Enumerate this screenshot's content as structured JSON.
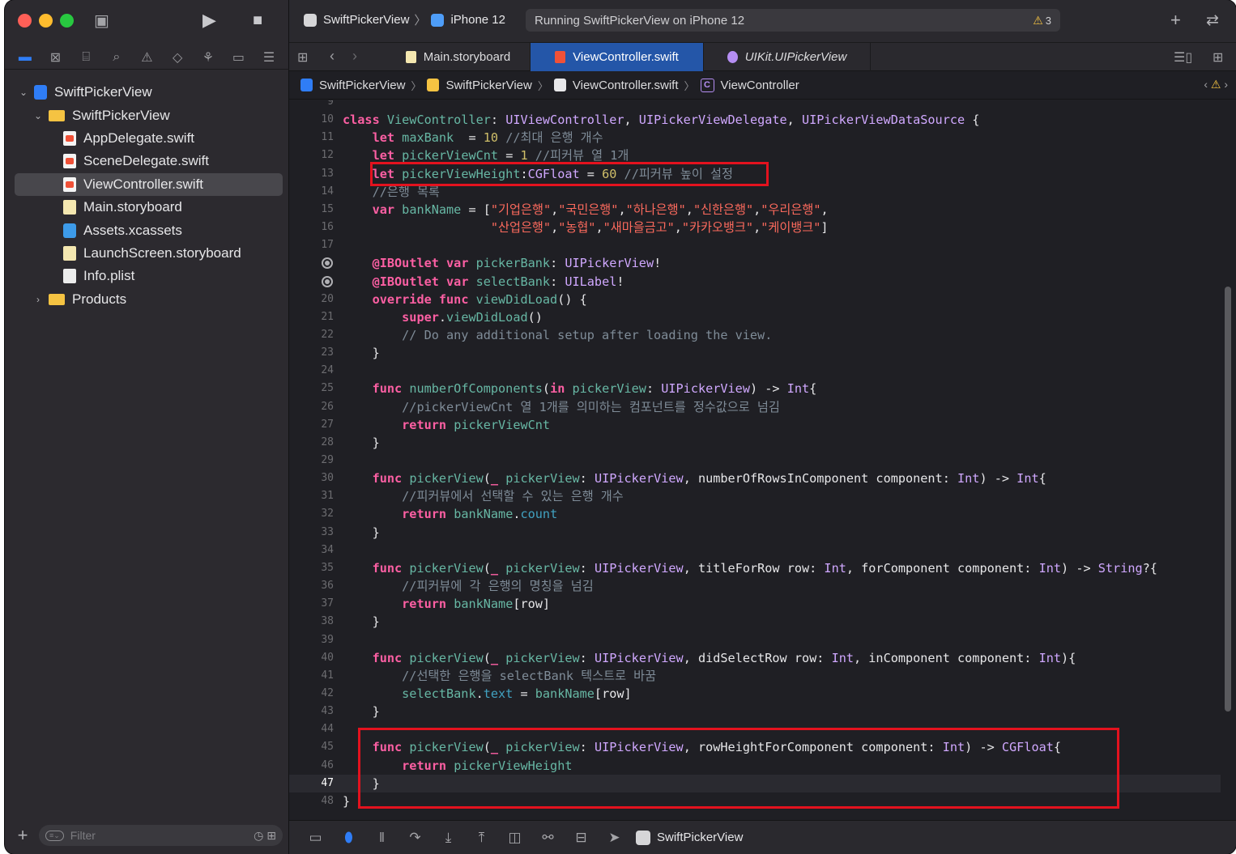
{
  "toolbar": {
    "scheme": "SwiftPickerView",
    "device": "iPhone 12",
    "activity": "Running SwiftPickerView on iPhone 12",
    "warning_count": "3"
  },
  "sidebar": {
    "tree": [
      {
        "label": "SwiftPickerView",
        "icon": "project-icon",
        "level": 0,
        "expanded": true
      },
      {
        "label": "SwiftPickerView",
        "icon": "folder-icon",
        "level": 1,
        "expanded": true
      },
      {
        "label": "AppDelegate.swift",
        "icon": "swift-file-icon",
        "level": 2
      },
      {
        "label": "SceneDelegate.swift",
        "icon": "swift-file-icon",
        "level": 2
      },
      {
        "label": "ViewController.swift",
        "icon": "swift-file-icon",
        "level": 2,
        "selected": true
      },
      {
        "label": "Main.storyboard",
        "icon": "storyboard-icon",
        "level": 2
      },
      {
        "label": "Assets.xcassets",
        "icon": "assets-icon",
        "level": 2
      },
      {
        "label": "LaunchScreen.storyboard",
        "icon": "storyboard-icon",
        "level": 2
      },
      {
        "label": "Info.plist",
        "icon": "plist-icon",
        "level": 2
      },
      {
        "label": "Products",
        "icon": "folder-icon",
        "level": 1,
        "expanded": false
      }
    ],
    "filter_placeholder": "Filter"
  },
  "tabs": [
    {
      "label": "Main.storyboard",
      "active": false
    },
    {
      "label": "ViewController.swift",
      "active": true
    },
    {
      "label": "UIKit.UIPickerView",
      "active": false
    }
  ],
  "breadcrumb": [
    "SwiftPickerView",
    "SwiftPickerView",
    "ViewController.swift",
    "ViewController"
  ],
  "editor": {
    "current_line": 47,
    "lines": [
      {
        "n": "9",
        "t": ""
      },
      {
        "n": "10",
        "t": "class ViewController: UIViewController, UIPickerViewDelegate, UIPickerViewDataSource {"
      },
      {
        "n": "11",
        "t": "    let maxBank  = 10 //최대 은행 개수"
      },
      {
        "n": "12",
        "t": "    let pickerViewCnt = 1 //피커뷰 열 1개"
      },
      {
        "n": "13",
        "t": "    let pickerViewHeight:CGFloat = 60 //피커뷰 높이 설정"
      },
      {
        "n": "14",
        "t": "    //은행 목록"
      },
      {
        "n": "15",
        "t": "    var bankName = [\"기업은행\",\"국민은행\",\"하나은행\",\"신한은행\",\"우리은행\","
      },
      {
        "n": "16",
        "t": "                    \"산업은행\",\"농협\",\"새마을금고\",\"카카오뱅크\",\"케이뱅크\"]"
      },
      {
        "n": "17",
        "t": ""
      },
      {
        "n": "18",
        "t": "    @IBOutlet var pickerBank: UIPickerView!",
        "breakpoint": true
      },
      {
        "n": "19",
        "t": "    @IBOutlet var selectBank: UILabel!",
        "breakpoint": true
      },
      {
        "n": "20",
        "t": "    override func viewDidLoad() {"
      },
      {
        "n": "21",
        "t": "        super.viewDidLoad()"
      },
      {
        "n": "22",
        "t": "        // Do any additional setup after loading the view."
      },
      {
        "n": "23",
        "t": "    }"
      },
      {
        "n": "24",
        "t": ""
      },
      {
        "n": "25",
        "t": "    func numberOfComponents(in pickerView: UIPickerView) -> Int{"
      },
      {
        "n": "26",
        "t": "        //pickerViewCnt 열 1개를 의미하는 컴포넌트를 정수값으로 넘김"
      },
      {
        "n": "27",
        "t": "        return pickerViewCnt"
      },
      {
        "n": "28",
        "t": "    }"
      },
      {
        "n": "29",
        "t": ""
      },
      {
        "n": "30",
        "t": "    func pickerView(_ pickerView: UIPickerView, numberOfRowsInComponent component: Int) -> Int{"
      },
      {
        "n": "31",
        "t": "        //피커뷰에서 선택할 수 있는 은행 개수"
      },
      {
        "n": "32",
        "t": "        return bankName.count"
      },
      {
        "n": "33",
        "t": "    }"
      },
      {
        "n": "34",
        "t": ""
      },
      {
        "n": "35",
        "t": "    func pickerView(_ pickerView: UIPickerView, titleForRow row: Int, forComponent component: Int) -> String?{"
      },
      {
        "n": "36",
        "t": "        //피커뷰에 각 은행의 명칭을 넘김"
      },
      {
        "n": "37",
        "t": "        return bankName[row]"
      },
      {
        "n": "38",
        "t": "    }"
      },
      {
        "n": "39",
        "t": ""
      },
      {
        "n": "40",
        "t": "    func pickerView(_ pickerView: UIPickerView, didSelectRow row: Int, inComponent component: Int){"
      },
      {
        "n": "41",
        "t": "        //선택한 은행을 selectBank 텍스트로 바꿈"
      },
      {
        "n": "42",
        "t": "        selectBank.text = bankName[row]"
      },
      {
        "n": "43",
        "t": "    }"
      },
      {
        "n": "44",
        "t": ""
      },
      {
        "n": "45",
        "t": "    func pickerView(_ pickerView: UIPickerView, rowHeightForComponent component: Int) -> CGFloat{"
      },
      {
        "n": "46",
        "t": "        return pickerViewHeight"
      },
      {
        "n": "47",
        "t": "    }"
      },
      {
        "n": "48",
        "t": "}"
      }
    ]
  },
  "debug": {
    "target": "SwiftPickerView"
  },
  "colors": {
    "accent": "#2f7df6",
    "highlight_box": "#e3121e",
    "active_tab": "#2456a8"
  }
}
